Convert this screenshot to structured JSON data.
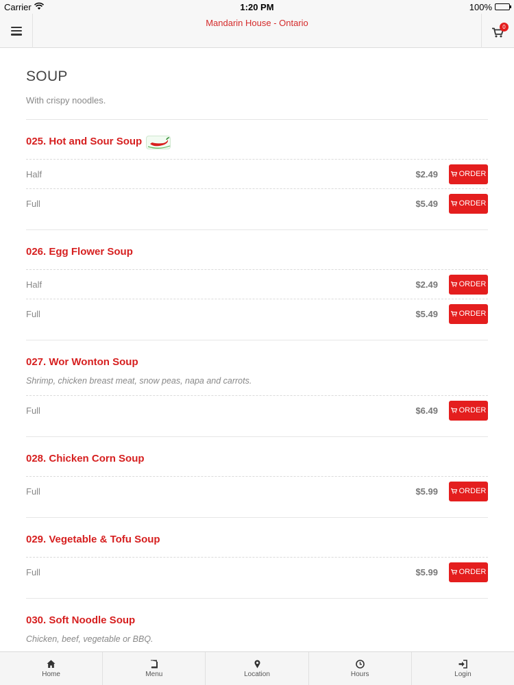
{
  "status_bar": {
    "carrier": "Carrier",
    "time": "1:20 PM",
    "battery": "100%"
  },
  "header": {
    "title": "Mandarin House - Ontario",
    "cart_count": "0"
  },
  "category": {
    "title": "SOUP",
    "description": "With crispy noodles."
  },
  "order_label": "ORDER",
  "items": [
    {
      "name": "025. Hot and Sour Soup",
      "spicy": true,
      "sizes": [
        {
          "label": "Half",
          "price": "$2.49"
        },
        {
          "label": "Full",
          "price": "$5.49"
        }
      ]
    },
    {
      "name": "026. Egg Flower Soup",
      "sizes": [
        {
          "label": "Half",
          "price": "$2.49"
        },
        {
          "label": "Full",
          "price": "$5.49"
        }
      ]
    },
    {
      "name": "027. Wor Wonton Soup",
      "description": "Shrimp, chicken breast meat, snow peas, napa and carrots.",
      "sizes": [
        {
          "label": "Full",
          "price": "$6.49"
        }
      ]
    },
    {
      "name": "028. Chicken Corn Soup",
      "sizes": [
        {
          "label": "Full",
          "price": "$5.99"
        }
      ]
    },
    {
      "name": "029. Vegetable & Tofu Soup",
      "sizes": [
        {
          "label": "Full",
          "price": "$5.99"
        }
      ]
    },
    {
      "name": "030. Soft Noodle Soup",
      "description": "Chicken, beef, vegetable or BBQ.",
      "sizes": []
    }
  ],
  "tabs": [
    {
      "label": "Home",
      "icon": "home-icon"
    },
    {
      "label": "Menu",
      "icon": "book-icon"
    },
    {
      "label": "Location",
      "icon": "map-pin-icon"
    },
    {
      "label": "Hours",
      "icon": "clock-icon"
    },
    {
      "label": "Login",
      "icon": "login-icon"
    }
  ],
  "colors": {
    "accent": "#e41e1e",
    "title_red": "#d61f1f",
    "header_bg": "#f7f7f7"
  }
}
